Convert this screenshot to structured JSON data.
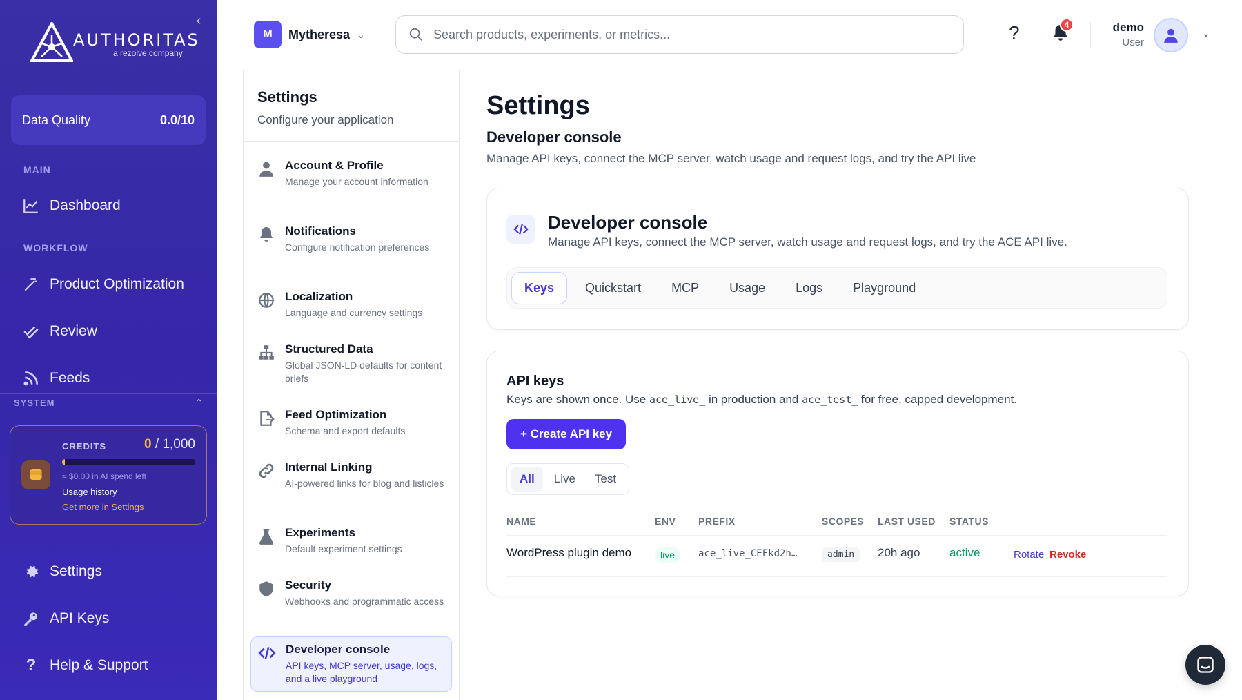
{
  "colors": {
    "sidebar": "#3527a8",
    "accent": "#4f32f0",
    "credits": "#f5b83d",
    "live": "#059669",
    "revoke": "#dc2626"
  },
  "sidebar": {
    "logo_word": "AUTHORITAS",
    "logo_tag": "a rezolve company",
    "data_quality_label": "Data Quality",
    "data_quality_value": "0.0/10",
    "main_label": "MAIN",
    "workflow_label": "WORKFLOW",
    "system_label": "SYSTEM",
    "items": [
      {
        "label": "Dashboard",
        "icon": "chart-line-icon"
      },
      {
        "label": "Product Optimization",
        "icon": "magic-wand-icon"
      },
      {
        "label": "Review",
        "icon": "double-check-icon"
      },
      {
        "label": "Feeds",
        "icon": "rss-icon"
      },
      {
        "label": "Settings",
        "icon": "gear-icon"
      },
      {
        "label": "API Keys",
        "icon": "key-icon"
      },
      {
        "label": "Help & Support",
        "icon": "question-icon"
      }
    ],
    "credits": {
      "label": "CREDITS",
      "used": "0",
      "total": "/ 1,000",
      "fraction": 0.0,
      "spend": "≈ $0.00 in AI spend left",
      "history": "Usage history",
      "more": "Get more in Settings"
    }
  },
  "topbar": {
    "store_initial": "M",
    "store_name": "Mytheresa",
    "search_placeholder": "Search products, experiments, or metrics...",
    "help": "?",
    "notification_count": "4",
    "user_name": "demo",
    "user_role": "User"
  },
  "settings_nav": {
    "title": "Settings",
    "subtitle": "Configure your application",
    "items": [
      {
        "label": "Account & Profile",
        "desc": "Manage your account information"
      },
      {
        "label": "Notifications",
        "desc": "Configure notification preferences"
      },
      {
        "label": "Localization",
        "desc": "Language and currency settings"
      },
      {
        "label": "Structured Data",
        "desc": "Global JSON-LD defaults for content briefs"
      },
      {
        "label": "Feed Optimization",
        "desc": "Schema and export defaults"
      },
      {
        "label": "Internal Linking",
        "desc": "AI-powered links for blog and listicles"
      },
      {
        "label": "Experiments",
        "desc": "Default experiment settings"
      },
      {
        "label": "Security",
        "desc": "Webhooks and programmatic access"
      },
      {
        "label": "Developer console",
        "desc": "API keys, MCP server, usage, logs, and a live playground"
      }
    ]
  },
  "main": {
    "title": "Settings",
    "subtitle": "Developer console",
    "desc": "Manage API keys, connect the MCP server, watch usage and request logs, and try the API live",
    "console": {
      "title": "Developer console",
      "desc": "Manage API keys, connect the MCP server, watch usage and request logs, and try the ACE API live.",
      "tabs": [
        "Keys",
        "Quickstart",
        "MCP",
        "Usage",
        "Logs",
        "Playground"
      ]
    },
    "api_keys": {
      "title": "API keys",
      "desc_a": "Keys are shown once. Use ",
      "code_live": "ace_live_",
      "desc_b": " in production and ",
      "code_test": "ace_test_",
      "desc_c": " for free, capped development.",
      "create": "+ Create API key",
      "filters": [
        "All",
        "Live",
        "Test"
      ],
      "columns": [
        "NAME",
        "ENV",
        "PREFIX",
        "SCOPES",
        "LAST USED",
        "STATUS"
      ],
      "rows": [
        {
          "name": "WordPress plugin demo",
          "env": "live",
          "prefix": "ace_live_CEFkd2h…",
          "scopes": "admin",
          "last_used": "20h ago",
          "status": "active",
          "rotate": "Rotate",
          "revoke": "Revoke"
        }
      ]
    }
  }
}
